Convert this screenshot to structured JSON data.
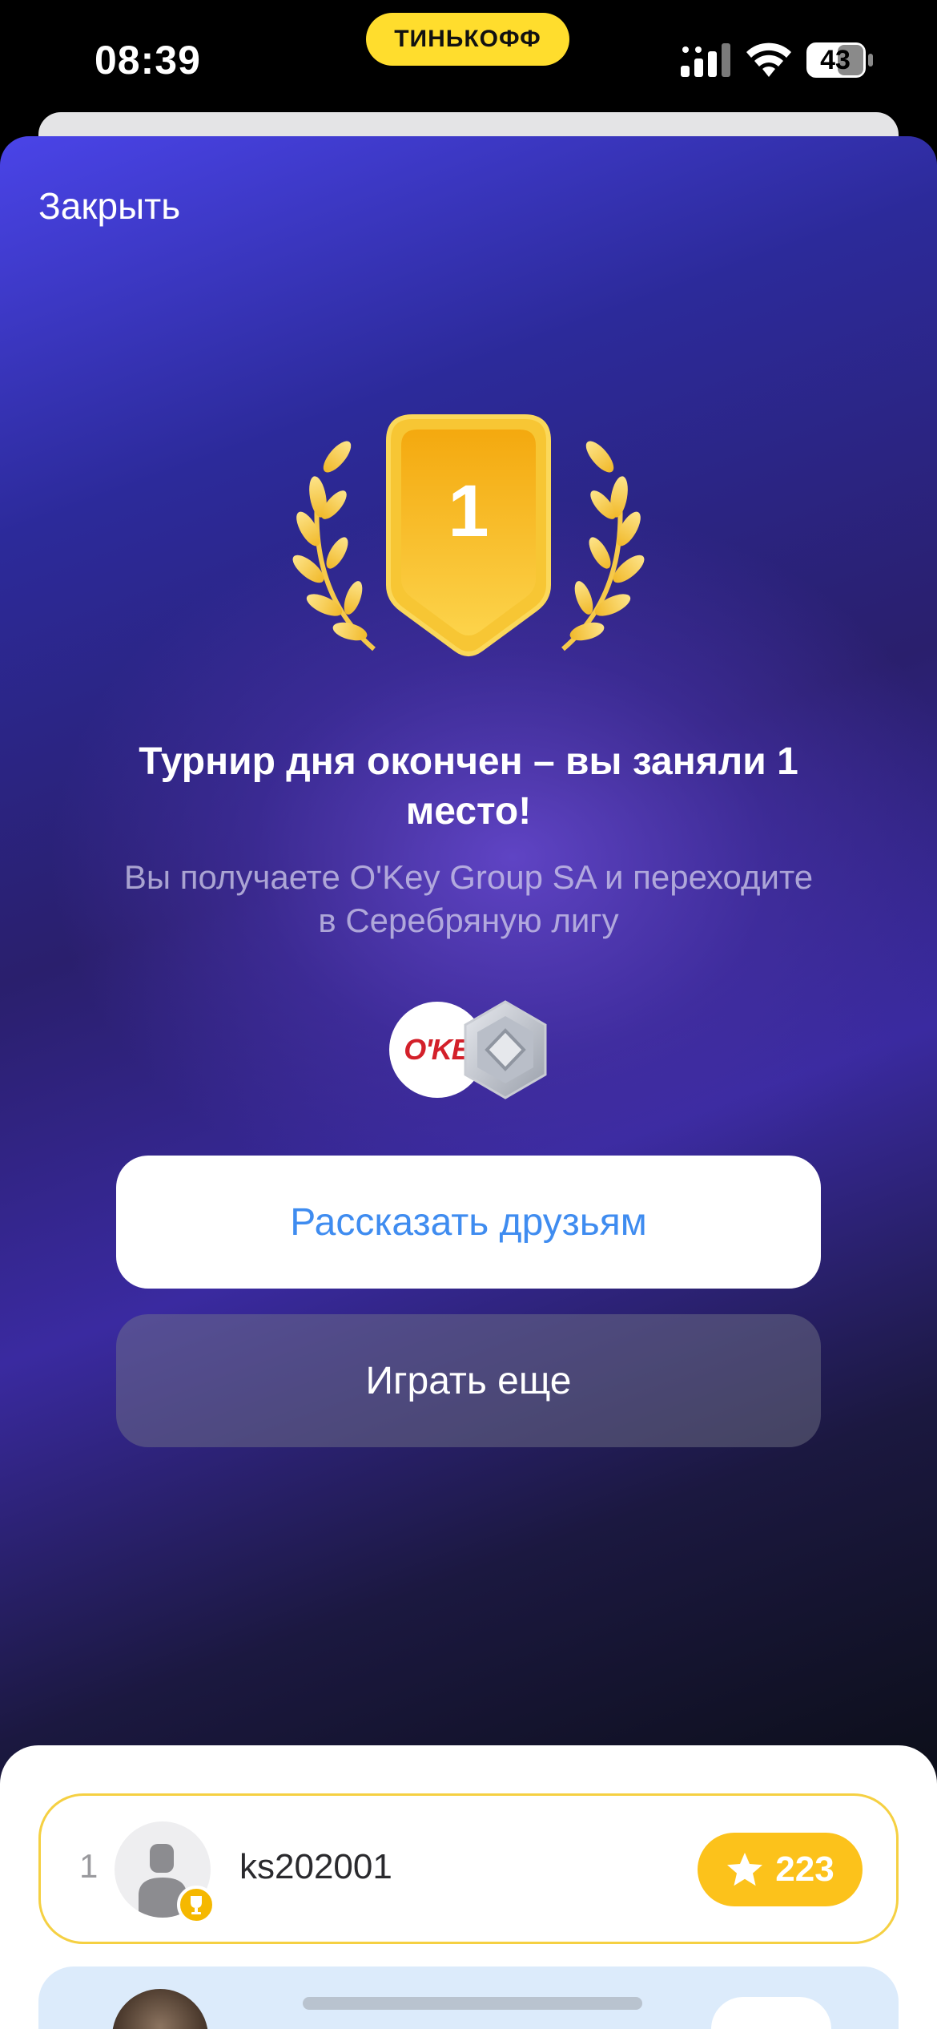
{
  "status_bar": {
    "time": "08:39",
    "brand": "ТИНЬКОФФ",
    "battery": "43",
    "icons": [
      "cellular-signal-icon",
      "wifi-icon",
      "battery-icon"
    ]
  },
  "modal": {
    "close_label": "Закрыть",
    "place_number": "1",
    "title": "Турнир дня окончен – вы заняли 1 место!",
    "subtitle": "Вы получаете O'Key Group SA и переходите в Серебряную лигу",
    "reward_logo_text": "O'KEY",
    "league_icon": "silver-league-icon",
    "share_button": "Рассказать друзьям",
    "play_button": "Играть еще"
  },
  "leaderboard": {
    "rows": [
      {
        "rank": "1",
        "username": "ks202001",
        "score": "223"
      }
    ]
  },
  "colors": {
    "brand_yellow": "#ffdd2d",
    "accent_blue": "#3f8cf0",
    "score_yellow": "#fcc21b"
  }
}
